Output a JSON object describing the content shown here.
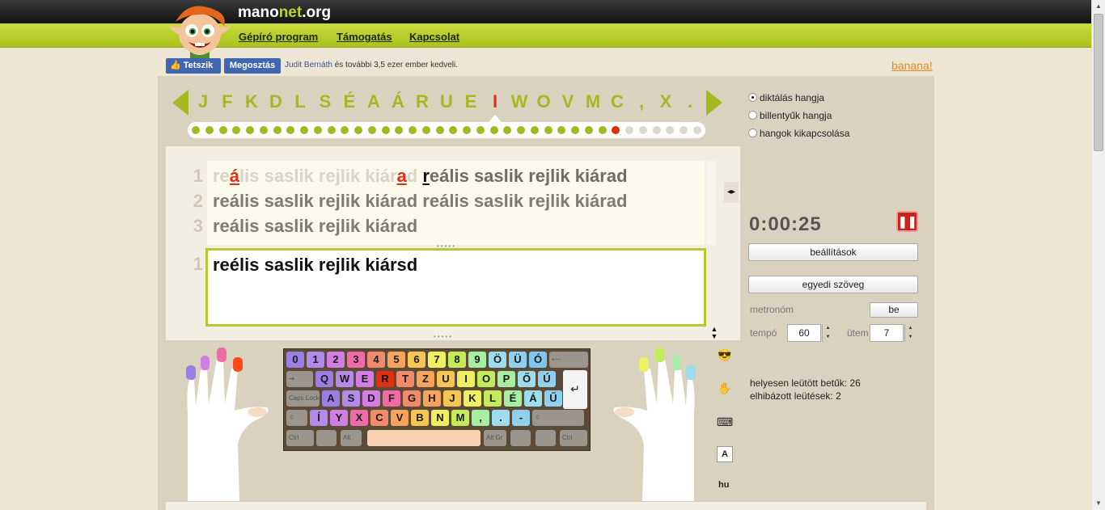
{
  "site": {
    "name_main": "mano",
    "name_accent": "net",
    "name_tld": ".org"
  },
  "nav": {
    "items": [
      {
        "label": "Gépíró program"
      },
      {
        "label": "Támogatás"
      },
      {
        "label": "Kapcsolat"
      }
    ]
  },
  "social": {
    "like_label": "Tetszik",
    "share_label": "Megosztás",
    "liker_name": "Judit Bernáth",
    "like_text": " és további 3,5 ezer ember kedveli."
  },
  "banana_link": "banana!",
  "lesson": {
    "letters": [
      "J",
      "F",
      "K",
      "D",
      "L",
      "S",
      "É",
      "A",
      "Á",
      "R",
      "U",
      "E",
      "I",
      "W",
      "O",
      "V",
      "M",
      "C",
      ",",
      "X",
      "."
    ],
    "active_letter_index": 12,
    "progress": {
      "total_dots": 38,
      "completed_dots": 31,
      "current_dot": 32
    }
  },
  "source_text": {
    "line_numbers": [
      "1",
      "2",
      "3"
    ],
    "line1": {
      "done_a": "re",
      "error_1": "á",
      "done_b": "lis saslik rejlik kiár",
      "error_2": "a",
      "done_c": "d ",
      "current": "r",
      "rest": "eális saslik rejlik kiárad"
    },
    "line2": "reális saslik rejlik kiárad reális saslik rejlik kiárad",
    "line3": "reális saslik rejlik kiárad"
  },
  "typed": {
    "line_number": "1",
    "text": "reélis saslik rejlik kiársd"
  },
  "keyboard": {
    "row1": [
      "0",
      "1",
      "2",
      "3",
      "4",
      "5",
      "6",
      "7",
      "8",
      "9",
      "Ö",
      "Ü",
      "Ó"
    ],
    "row2": [
      "Q",
      "W",
      "E",
      "R",
      "T",
      "Z",
      "U",
      "I",
      "O",
      "P",
      "Ő",
      "Ú"
    ],
    "row3": [
      "A",
      "S",
      "D",
      "F",
      "G",
      "H",
      "J",
      "K",
      "L",
      "É",
      "Á",
      "Ű"
    ],
    "row4": [
      "Í",
      "Y",
      "X",
      "C",
      "V",
      "B",
      "N",
      "M",
      ",",
      ".",
      "-"
    ],
    "caps_label": "Caps Lock",
    "ctrl_label": "Ctrl",
    "alt_label": "Alt",
    "altgr_label": "Alt Gr",
    "highlighted_key": "R"
  },
  "tools": {
    "a_label": "A",
    "lang_label": "hu"
  },
  "sound": {
    "options": [
      {
        "label": "diktálás hangja",
        "selected": true
      },
      {
        "label": "billentyűk hangja",
        "selected": false
      },
      {
        "label": "hangok kikapcsolása",
        "selected": false
      }
    ]
  },
  "timer": "0:00:25",
  "buttons": {
    "settings": "beállítások",
    "custom_text": "egyedi szöveg",
    "metronome_toggle": "be"
  },
  "metronome": {
    "label": "metronóm",
    "tempo_label": "tempó",
    "tempo_value": "60",
    "beat_label": "ütem",
    "beat_value": "7"
  },
  "stats": {
    "correct_label": "helyesen leütött betűk:",
    "correct_value": "26",
    "wrong_label": "elhibázott leütések:",
    "wrong_value": "2"
  },
  "colors": {
    "accent": "#a3b922",
    "error": "#e32d0f",
    "timer_button": "#c9231b",
    "facebook": "#4267b2",
    "banana": "#e58a1f"
  }
}
